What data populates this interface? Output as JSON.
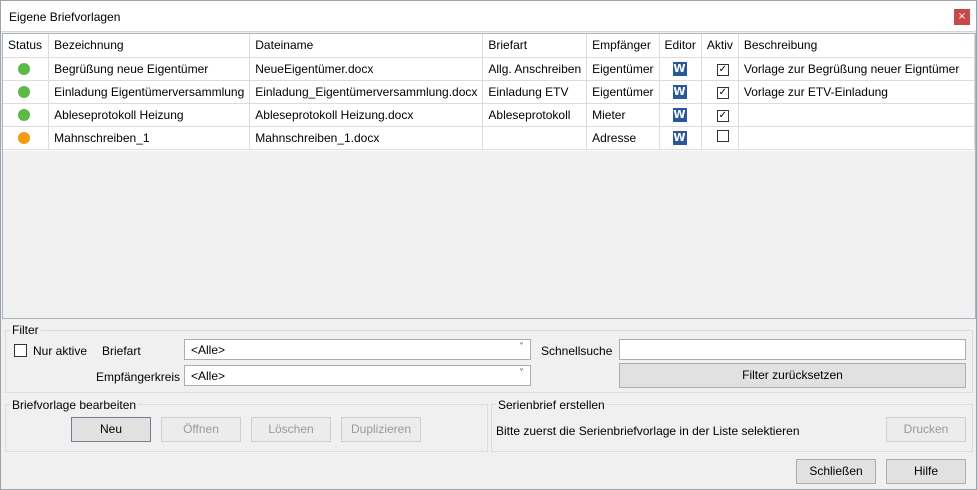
{
  "window": {
    "title": "Eigene Briefvorlagen",
    "close_label": "×"
  },
  "grid": {
    "columns": [
      "Status",
      "Bezeichnung",
      "Dateiname",
      "Briefart",
      "Empfänger",
      "Editor",
      "Aktiv",
      "Beschreibung"
    ],
    "rows": [
      {
        "status_color": "#5cb944",
        "bezeichnung": "Begrüßung neue Eigentümer",
        "dateiname": "NeueEigentümer.docx",
        "briefart": "Allg. Anschreiben",
        "empfaenger": "Eigentümer",
        "editor": "W",
        "aktiv": "✓",
        "beschreibung": "Vorlage zur Begrüßung neuer Eigntümer"
      },
      {
        "status_color": "#5cb944",
        "bezeichnung": "Einladung Eigentümerversammlung",
        "dateiname": "Einladung_Eigentümerversammlung.docx",
        "briefart": "Einladung ETV",
        "empfaenger": "Eigentümer",
        "editor": "W",
        "aktiv": "✓",
        "beschreibung": "Vorlage zur ETV-Einladung"
      },
      {
        "status_color": "#5cb944",
        "bezeichnung": "Ableseprotokoll Heizung",
        "dateiname": "Ableseprotokoll Heizung.docx",
        "briefart": "Ableseprotokoll",
        "empfaenger": "Mieter",
        "editor": "W",
        "aktiv": "✓",
        "beschreibung": ""
      },
      {
        "status_color": "#f39c12",
        "bezeichnung": "Mahnschreiben_1",
        "dateiname": "Mahnschreiben_1.docx",
        "briefart": "",
        "empfaenger": "Adresse",
        "editor": "W",
        "aktiv": "",
        "beschreibung": ""
      }
    ]
  },
  "filter": {
    "group_label": "Filter",
    "nur_aktive_label": "Nur aktive",
    "briefart_label": "Briefart",
    "briefart_value": "<Alle>",
    "empfaengerkreis_label": "Empfängerkreis",
    "empfaengerkreis_value": "<Alle>",
    "schnellsuche_label": "Schnellsuche",
    "schnellsuche_value": "",
    "reset_label": "Filter zurücksetzen"
  },
  "bearbeiten": {
    "group_label": "Briefvorlage bearbeiten",
    "neu": "Neu",
    "oeffnen": "Öffnen",
    "loeschen": "Löschen",
    "duplizieren": "Duplizieren"
  },
  "serienbrief": {
    "group_label": "Serienbrief erstellen",
    "hint": "Bitte zuerst die Serienbriefvorlage in der Liste selektieren",
    "drucken": "Drucken"
  },
  "footer": {
    "schliessen": "Schließen",
    "hilfe": "Hilfe"
  },
  "icons": {
    "chevron": "˅"
  }
}
